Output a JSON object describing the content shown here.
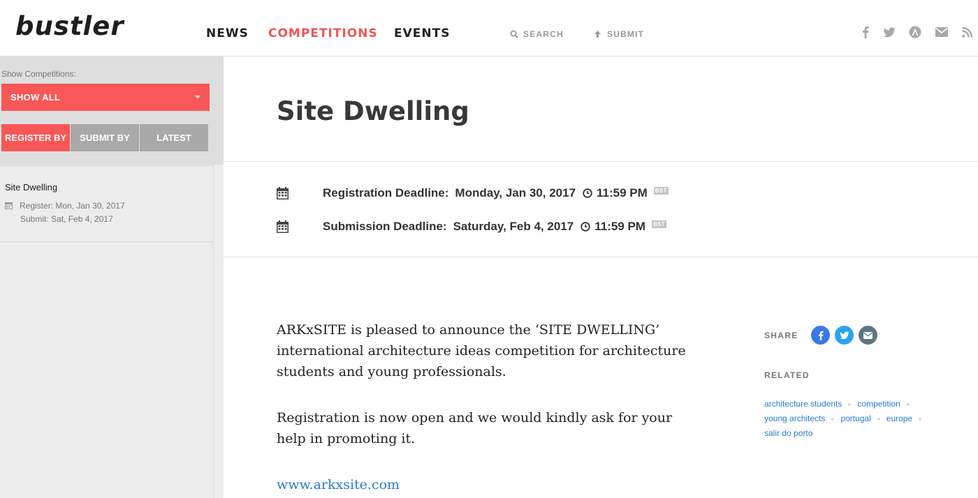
{
  "header": {
    "logo": "bustler",
    "nav": [
      {
        "label": "NEWS",
        "active": false
      },
      {
        "label": "COMPETITIONS",
        "active": true
      },
      {
        "label": "EVENTS",
        "active": false
      }
    ],
    "search_label": "SEARCH",
    "submit_label": "SUBMIT",
    "social_icons": [
      "facebook-icon",
      "twitter-icon",
      "archinect-icon",
      "mail-icon",
      "rss-icon"
    ]
  },
  "sidebar": {
    "filter_label": "Show Competitions:",
    "dropdown_value": "SHOW ALL",
    "sort_buttons": [
      {
        "label": "REGISTER BY",
        "active": true
      },
      {
        "label": "SUBMIT BY",
        "active": false
      },
      {
        "label": "LATEST",
        "active": false
      }
    ],
    "competitions": [
      {
        "title": "Site Dwelling",
        "register": "Register: Mon, Jan 30, 2017",
        "submit": "Submit: Sat, Feb 4, 2017"
      }
    ]
  },
  "main": {
    "title": "Site Dwelling",
    "deadlines": [
      {
        "label": "Registration Deadline:",
        "date": "Monday, Jan 30, 2017",
        "time": "11:59 PM",
        "tz": "BST"
      },
      {
        "label": "Submission Deadline:",
        "date": "Saturday, Feb 4, 2017",
        "time": "11:59 PM",
        "tz": "BST"
      }
    ],
    "paragraphs": [
      "ARKxSITE is pleased to announce the ‘SITE DWELLING’ international architecture ideas competition for architecture students and young professionals.",
      "Registration is now open and we would kindly ask for your help in promoting it."
    ],
    "link": "www.arkxsite.com"
  },
  "aside": {
    "share_label": "SHARE",
    "share_buttons": [
      {
        "icon": "facebook-icon",
        "color": "#3b78e7"
      },
      {
        "icon": "twitter-icon",
        "color": "#2aa3ef"
      },
      {
        "icon": "mail-icon",
        "color": "#5b7682"
      }
    ],
    "related_label": "RELATED",
    "tags": [
      "architecture students",
      "competition",
      "young architects",
      "portugal",
      "europe",
      "salir do porto"
    ]
  },
  "colors": {
    "accent": "#f95757",
    "link": "#2a7ad1"
  }
}
